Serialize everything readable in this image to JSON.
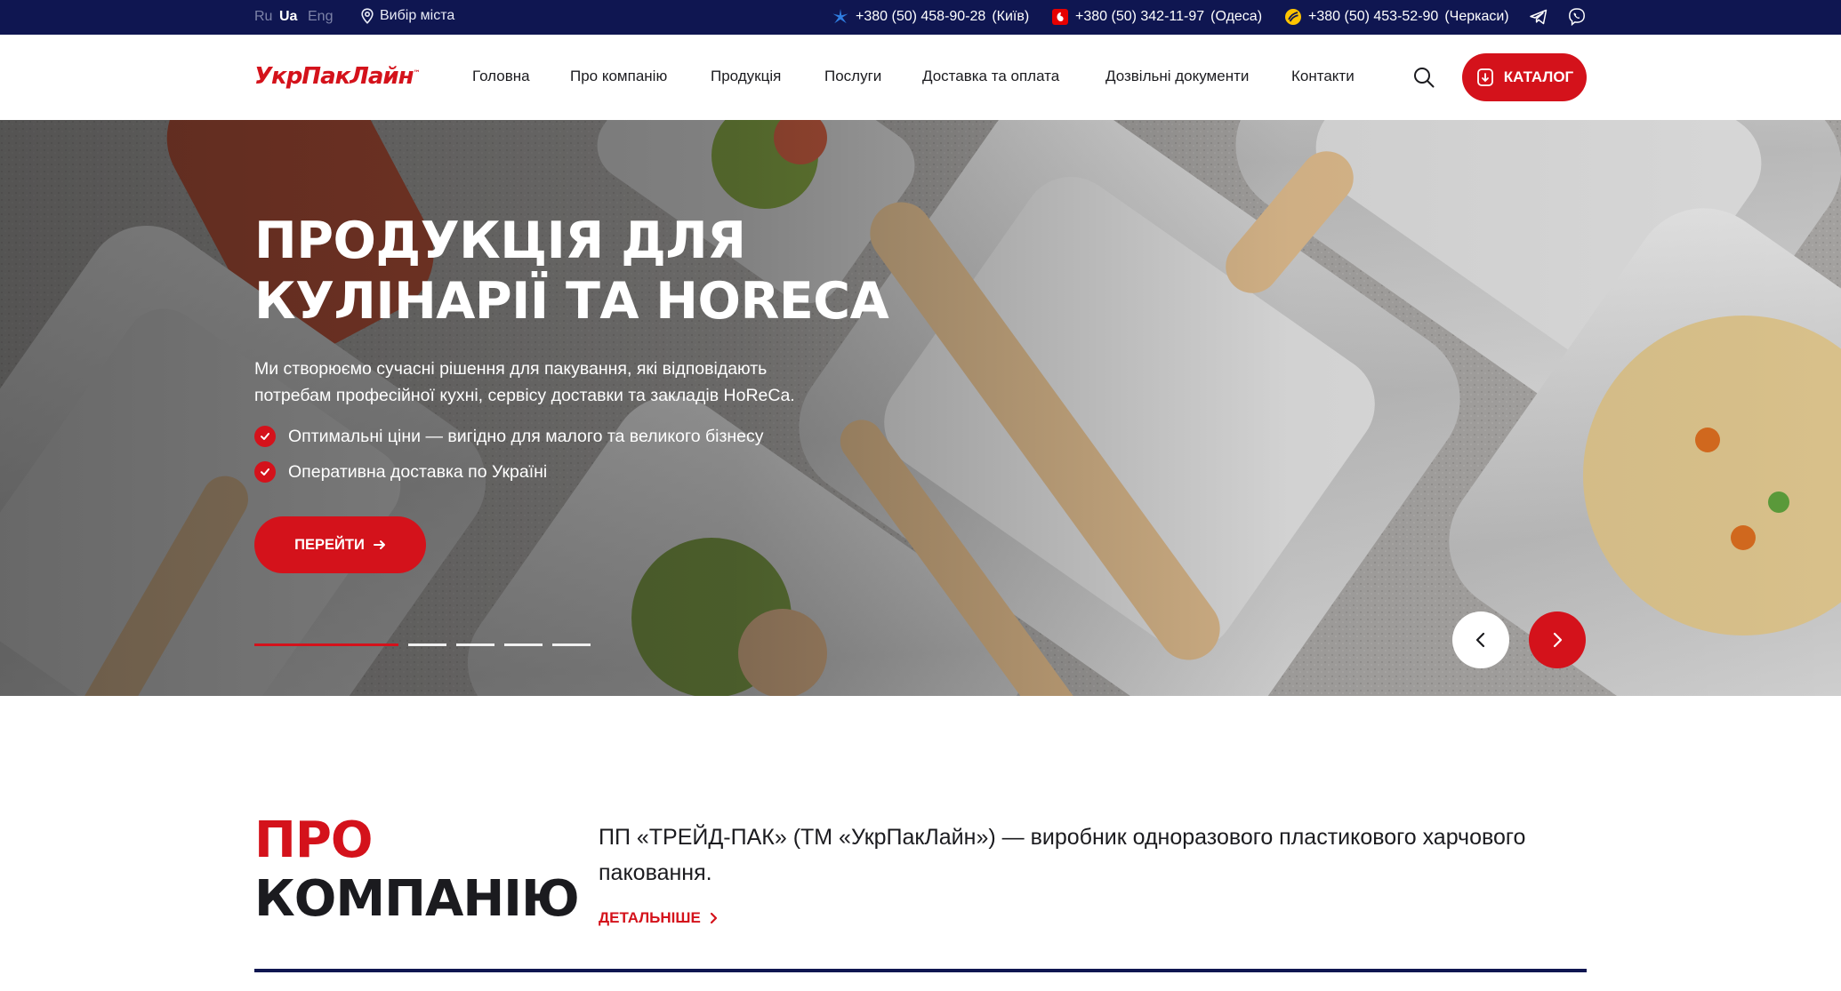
{
  "topbar": {
    "languages": [
      "Ru",
      "Ua",
      "Eng"
    ],
    "active_language": "Ua",
    "city_label": "Вибір міста",
    "phones": [
      {
        "operator_icon": "kyivstar-icon",
        "number": "+380 (50) 458-90-28",
        "city": "(Київ)",
        "color": "#2f7de1"
      },
      {
        "operator_icon": "vodafone-icon",
        "number": "+380 (50) 342-11-97",
        "city": "(Одеса)",
        "color": "#e60000"
      },
      {
        "operator_icon": "lifecell-icon",
        "number": "+380 (50) 453-52-90",
        "city": "(Черкаси)",
        "color": "#ffc400"
      }
    ],
    "social_icons": [
      "telegram-icon",
      "viber-icon"
    ]
  },
  "header": {
    "logo_text": "УкрПакЛайн",
    "logo_mark": "™",
    "nav": [
      "Головна",
      "Про компанію",
      "Продукція",
      "Послуги",
      "Доставка та оплата",
      "Дозвільні документи",
      "Контакти"
    ],
    "catalog_label": "КАТАЛОГ"
  },
  "hero": {
    "title_lines": [
      "ПРОДУКЦІЯ ДЛЯ",
      "КУЛІНАРІЇ ТА HORECA"
    ],
    "text_lines": [
      "Ми створюємо сучасні рішення для пакування, які відповідають",
      "потребам професійної кухні, сервісу доставки та закладів HoReCa."
    ],
    "bullets": [
      "Оптимальні ціни — вигідно для малого та великого бізнесу",
      "Оперативна доставка по Україні"
    ],
    "button_label": "ПЕРЕЙТИ",
    "slides_total": 5,
    "active_slide": 1
  },
  "about": {
    "title_red": "ПРО",
    "title_dark": "КОМПАНІЮ",
    "text_line1": "ПП «ТРЕЙД-ПАК» (ТМ «УкрПакЛайн») — виробник одноразового пластикового харчового",
    "text_line2": "паковання.",
    "more_label": "ДЕТАЛЬНІШЕ"
  },
  "colors": {
    "navy": "#0f1651",
    "brand_red": "#d4121b",
    "text_dark": "#1b1b1f"
  }
}
